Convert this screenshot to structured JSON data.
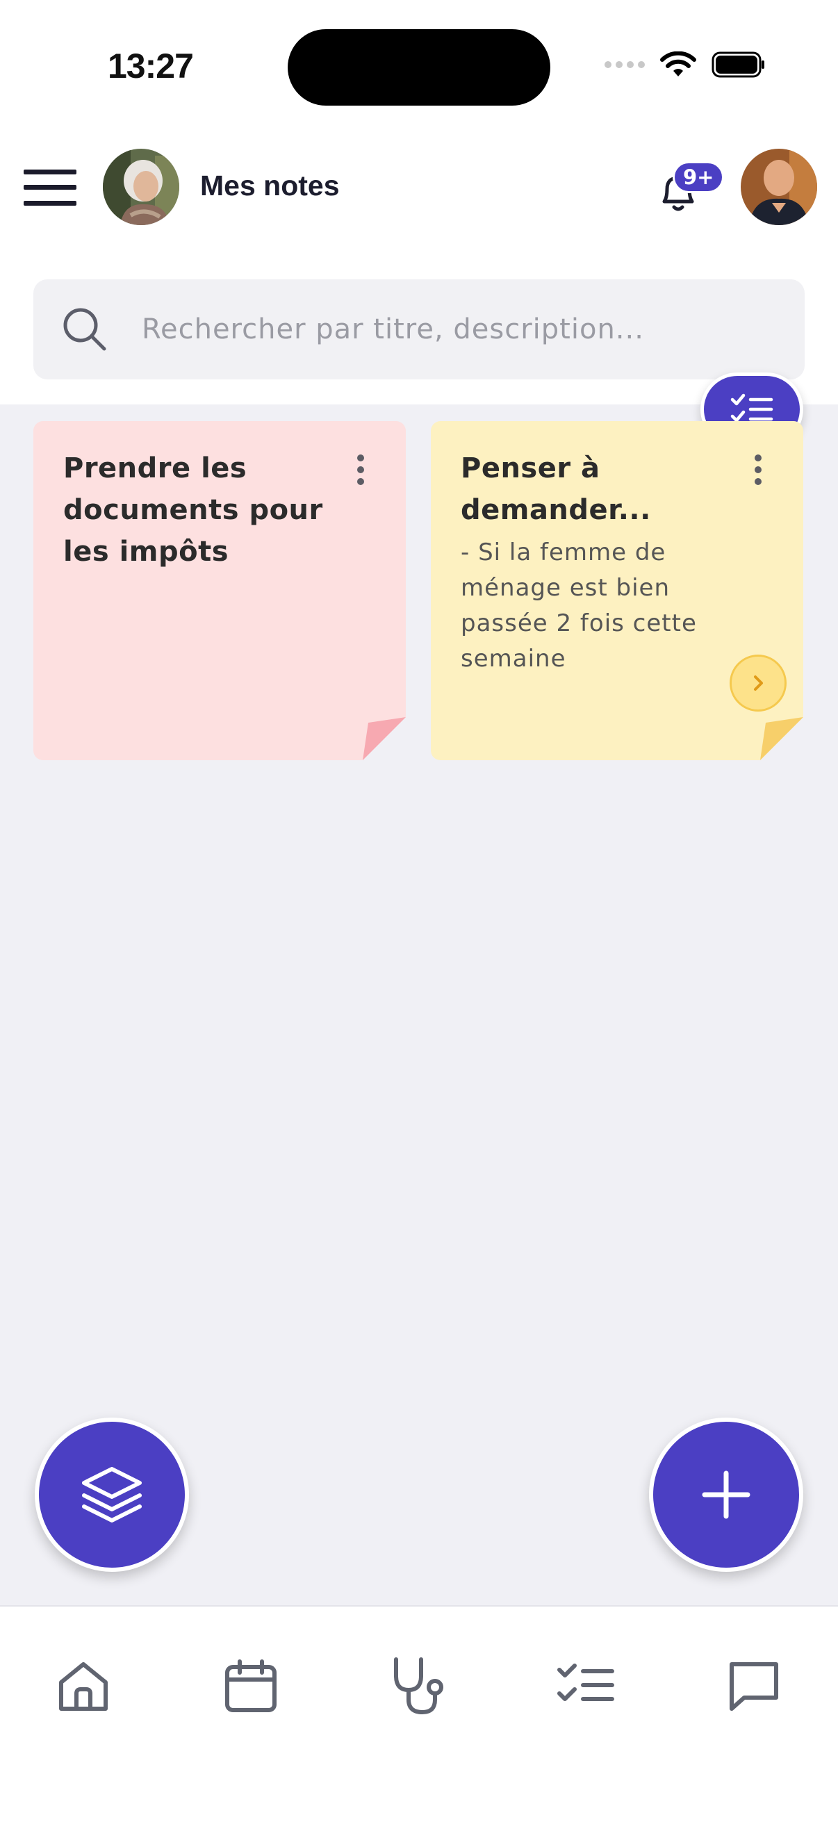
{
  "status_bar": {
    "time": "13:27"
  },
  "header": {
    "title": "Mes notes",
    "notification_badge": "9+",
    "icons": {
      "menu": "hamburger-menu-icon",
      "bell": "bell-icon"
    }
  },
  "search": {
    "placeholder": "Rechercher par titre, description..."
  },
  "notes": [
    {
      "title": "Prendre les documents pour les impôts",
      "description": "",
      "color": "#fde0e0"
    },
    {
      "title": "Penser à demander...",
      "description": "- Si la femme de ménage est bien passée 2 fois cette semaine",
      "color": "#fdf1c1"
    }
  ],
  "colors": {
    "accent": "#4b3fc3",
    "background": "#f0f0f5",
    "note_pink": "#fde0e0",
    "note_yellow": "#fdf1c1"
  },
  "bottom_nav": [
    {
      "name": "home",
      "icon": "home-icon"
    },
    {
      "name": "calendar",
      "icon": "calendar-icon"
    },
    {
      "name": "health",
      "icon": "stethoscope-icon"
    },
    {
      "name": "tasks",
      "icon": "checklist-icon"
    },
    {
      "name": "messages",
      "icon": "chat-icon"
    }
  ]
}
